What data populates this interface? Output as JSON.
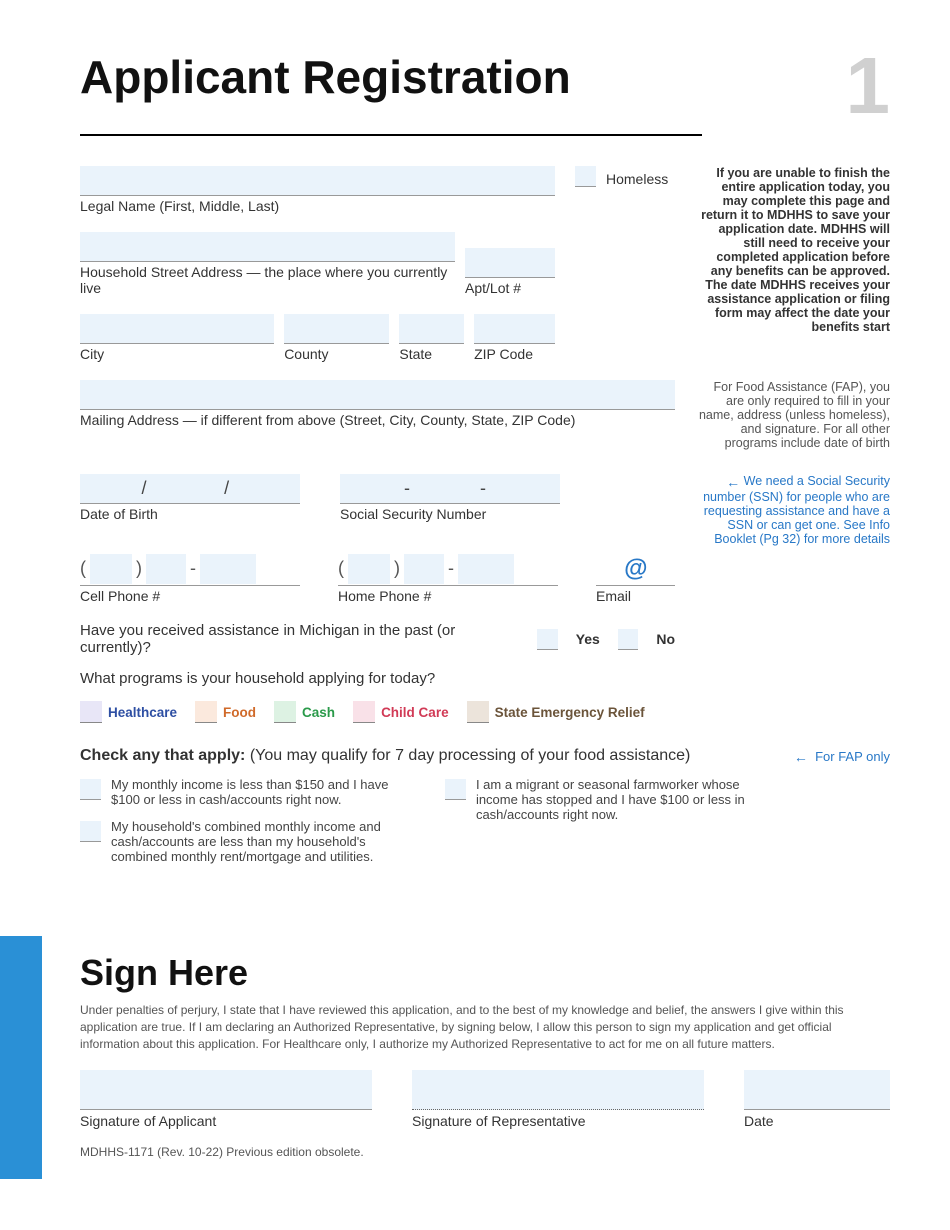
{
  "header": {
    "title": "Applicant Registration",
    "page_number": "1"
  },
  "side": {
    "bold_note": "If you are unable to finish the entire application today, you may complete this page and return it to MDHHS to save your application date. MDHHS will still need to receive your completed application before any benefits can be approved. The date MDHHS receives your assistance application or filing form may affect the date your benefits start",
    "fap_note": "For Food Assistance (FAP), you are only required to fill in your name, address (unless homeless), and signature. For all other programs include date of birth",
    "ssn_note": "We need a Social Security number (SSN) for people who are requesting assistance and have a SSN or can get one. See Info Booklet (Pg 32) for more details"
  },
  "fields": {
    "legal_name_label": "Legal Name (First, Middle, Last)",
    "homeless_label": "Homeless",
    "street_label": "Household Street Address — the place where you currently live",
    "apt_label": "Apt/Lot #",
    "city_label": "City",
    "county_label": "County",
    "state_label": "State",
    "zip_label": "ZIP Code",
    "mailing_label": "Mailing Address — if different from above (Street, City, County, State, ZIP Code)",
    "dob_label": "Date of Birth",
    "ssn_label": "Social Security Number",
    "cell_label": "Cell Phone #",
    "home_label": "Home Phone #",
    "email_label": "Email",
    "email_at": "@",
    "slash": "/",
    "dash": "-",
    "paren_l": "(",
    "paren_r": ")"
  },
  "questions": {
    "past_assistance": "Have you received assistance in Michigan in the past (or currently)?",
    "yes": "Yes",
    "no": "No",
    "programs_q": "What programs is your household applying for today?"
  },
  "programs": {
    "healthcare": "Healthcare",
    "food": "Food",
    "cash": "Cash",
    "child": "Child Care",
    "ser": "State Emergency Relief"
  },
  "fap": {
    "heading_bold": "Check any that apply:",
    "heading_rest": " (You may qualify for 7 day processing of your food assistance)",
    "fap_only": "For FAP only",
    "opt1": "My monthly income is less than $150 and I have $100 or less in cash/accounts right now.",
    "opt2": "My household's combined monthly income and cash/accounts are less than my household's combined monthly rent/mortgage and utilities.",
    "opt3": "I am a migrant or seasonal farmworker whose income has stopped and I have $100 or less in cash/accounts right now."
  },
  "sign": {
    "title": "Sign Here",
    "text": "Under penalties of perjury, I state that I have reviewed this application, and to the best of my knowledge and belief, the answers I give within this application are true. If I am declaring an Authorized Representative, by signing below, I allow this person to sign my application and get official information about this application. For Healthcare only, I authorize my Authorized Representative to act for me on all future matters.",
    "sig_app": "Signature of Applicant",
    "sig_rep": "Signature of Representative",
    "date": "Date"
  },
  "footer": "MDHHS-1171 (Rev. 10-22) Previous edition obsolete."
}
